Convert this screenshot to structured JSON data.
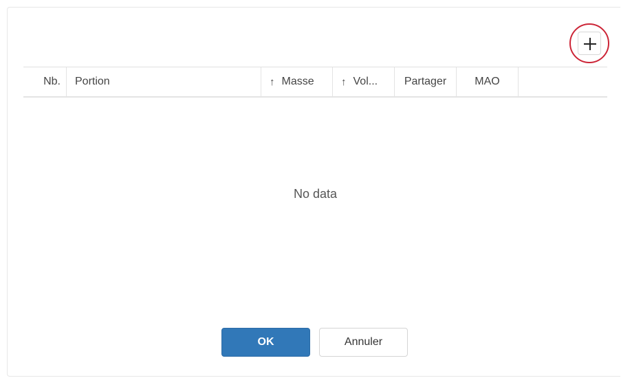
{
  "toolbar": {
    "add_icon": "plus-icon"
  },
  "table": {
    "columns": [
      {
        "label": "Nb.",
        "sortable": false
      },
      {
        "label": "Portion",
        "sortable": false
      },
      {
        "label": "Masse",
        "sortable": true,
        "sort_icon": "↑"
      },
      {
        "label": "Vol...",
        "sortable": true,
        "sort_icon": "↑"
      },
      {
        "label": "Partager",
        "sortable": false
      },
      {
        "label": "MAO",
        "sortable": false
      }
    ],
    "rows": [],
    "empty_text": "No data"
  },
  "footer": {
    "ok_label": "OK",
    "cancel_label": "Annuler"
  },
  "colors": {
    "primary": "#3178b8",
    "highlight_ring": "#cc2436"
  }
}
